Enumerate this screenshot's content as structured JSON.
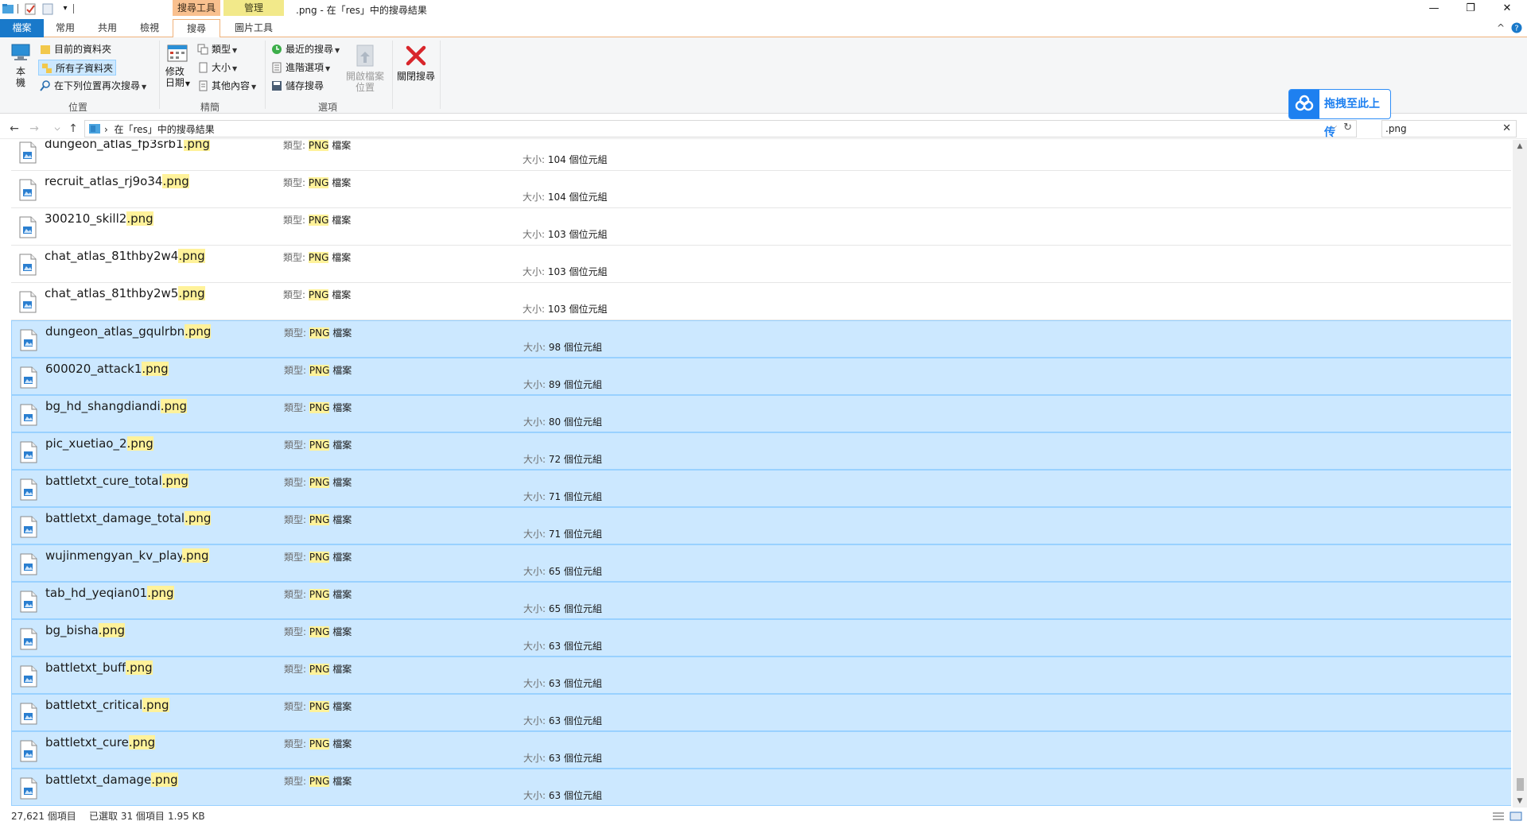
{
  "window": {
    "title": ".png - 在「res」中的搜尋結果",
    "context_search_tools": "搜尋工具",
    "context_manage": "管理",
    "minimize": "—",
    "restore": "❐",
    "close": "✕"
  },
  "tabs": {
    "file": "檔案",
    "home": "常用",
    "share": "共用",
    "view": "檢視",
    "search": "搜尋",
    "picture_tools": "圖片工具"
  },
  "ribbon": {
    "location": {
      "this_pc": "本機",
      "current_folder": "目前的資料夾",
      "all_subfolders": "所有子資料夾",
      "search_again_in": "在下列位置再次搜尋",
      "label": "位置"
    },
    "refine": {
      "date_modified": "修改日期",
      "kind": "類型",
      "size": "大小",
      "other_properties": "其他內容",
      "label": "精簡"
    },
    "options": {
      "recent_searches": "最近的搜尋",
      "advanced_options": "進階選項",
      "save_search": "儲存搜尋",
      "open_file_location": "開啟檔案位置",
      "label": "選項"
    },
    "close_search": "關閉搜尋"
  },
  "upload_button": "拖拽至此上传",
  "address": {
    "breadcrumb": "在「res」中的搜尋結果",
    "search_value": ".png"
  },
  "labels": {
    "type_prefix": "類型: ",
    "size_prefix": "大小: "
  },
  "files": [
    {
      "base": "dungeon_atlas_fp3srb1",
      "ext": ".png",
      "type": "PNG 檔案",
      "size": "104 個位元組",
      "selected": false
    },
    {
      "base": "recruit_atlas_rj9o34",
      "ext": ".png",
      "type": "PNG 檔案",
      "size": "104 個位元組",
      "selected": false
    },
    {
      "base": "300210_skill2",
      "ext": ".png",
      "type": "PNG 檔案",
      "size": "103 個位元組",
      "selected": false
    },
    {
      "base": "chat_atlas_81thby2w4",
      "ext": ".png",
      "type": "PNG 檔案",
      "size": "103 個位元組",
      "selected": false
    },
    {
      "base": "chat_atlas_81thby2w5",
      "ext": ".png",
      "type": "PNG 檔案",
      "size": "103 個位元組",
      "selected": false
    },
    {
      "base": "dungeon_atlas_gqulrbn",
      "ext": ".png",
      "type": "PNG 檔案",
      "size": "98 個位元組",
      "selected": true
    },
    {
      "base": "600020_attack1",
      "ext": ".png",
      "type": "PNG 檔案",
      "size": "89 個位元組",
      "selected": true
    },
    {
      "base": "bg_hd_shangdiandi",
      "ext": ".png",
      "type": "PNG 檔案",
      "size": "80 個位元組",
      "selected": true
    },
    {
      "base": "pic_xuetiao_2",
      "ext": ".png",
      "type": "PNG 檔案",
      "size": "72 個位元組",
      "selected": true
    },
    {
      "base": "battletxt_cure_total",
      "ext": ".png",
      "type": "PNG 檔案",
      "size": "71 個位元組",
      "selected": true
    },
    {
      "base": "battletxt_damage_total",
      "ext": ".png",
      "type": "PNG 檔案",
      "size": "71 個位元組",
      "selected": true
    },
    {
      "base": "wujinmengyan_kv_play",
      "ext": ".png",
      "type": "PNG 檔案",
      "size": "65 個位元組",
      "selected": true
    },
    {
      "base": "tab_hd_yeqian01",
      "ext": ".png",
      "type": "PNG 檔案",
      "size": "65 個位元組",
      "selected": true
    },
    {
      "base": "bg_bisha",
      "ext": ".png",
      "type": "PNG 檔案",
      "size": "63 個位元組",
      "selected": true
    },
    {
      "base": "battletxt_buff",
      "ext": ".png",
      "type": "PNG 檔案",
      "size": "63 個位元組",
      "selected": true
    },
    {
      "base": "battletxt_critical",
      "ext": ".png",
      "type": "PNG 檔案",
      "size": "63 個位元組",
      "selected": true
    },
    {
      "base": "battletxt_cure",
      "ext": ".png",
      "type": "PNG 檔案",
      "size": "63 個位元組",
      "selected": true
    },
    {
      "base": "battletxt_damage",
      "ext": ".png",
      "type": "PNG 檔案",
      "size": "63 個位元組",
      "selected": true
    }
  ],
  "status": {
    "item_count": "27,621 個項目",
    "selected": "已選取 31 個項目",
    "selected_size": "1.95 KB"
  },
  "colors": {
    "accent": "#1979ca",
    "selection": "#cce8ff",
    "selection_border": "#99d1ff",
    "highlight": "#fff29a",
    "search_tools_tab": "#f9c08f",
    "manage_tab": "#f2e98a"
  }
}
